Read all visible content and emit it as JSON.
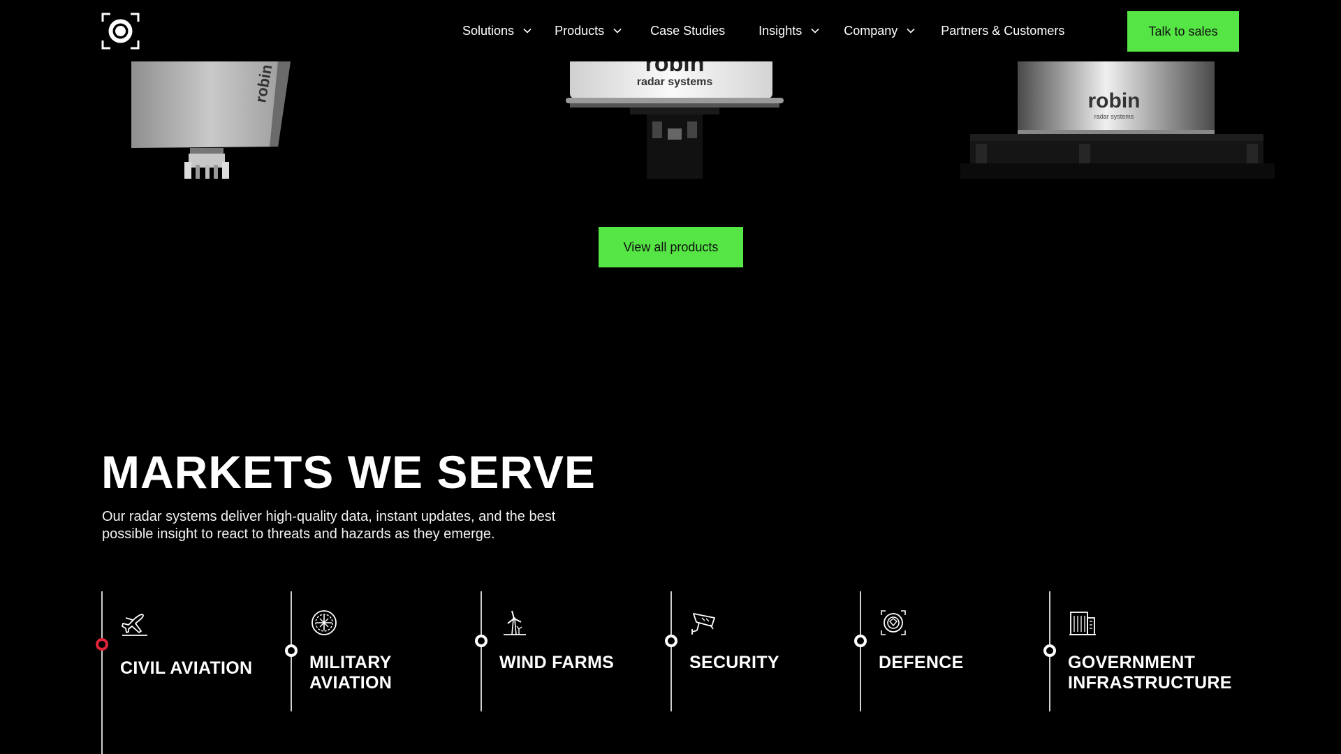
{
  "header": {
    "logo": "camera-aperture-logo",
    "nav": [
      {
        "label": "Solutions",
        "dropdown": true
      },
      {
        "label": "Products",
        "dropdown": true
      },
      {
        "label": "Case Studies",
        "dropdown": false
      },
      {
        "label": "Insights",
        "dropdown": true
      },
      {
        "label": "Company",
        "dropdown": true
      },
      {
        "label": "Partners & Customers",
        "dropdown": false
      }
    ],
    "cta_label": "Talk to sales"
  },
  "products": {
    "brand_text": "robin",
    "brand_sub": "radar systems",
    "view_all_label": "View all products"
  },
  "markets": {
    "title": "MARKETS WE SERVE",
    "description": "Our radar systems deliver high-quality data, instant updates, and the best possible insight to react to threats and hazards as they emerge.",
    "items": [
      {
        "label": "CIVIL AVIATION",
        "icon": "plane-icon",
        "active": true
      },
      {
        "label": "MILITARY AVIATION",
        "icon": "military-target-icon",
        "active": false
      },
      {
        "label": "WIND FARMS",
        "icon": "wind-turbine-icon",
        "active": false
      },
      {
        "label": "SECURITY",
        "icon": "security-camera-icon",
        "active": false
      },
      {
        "label": "DEFENCE",
        "icon": "defence-shield-icon",
        "active": false
      },
      {
        "label": "GOVERNMENT INFRASTRUCTURE",
        "icon": "building-icon",
        "active": false
      }
    ]
  },
  "colors": {
    "accent_green": "#55e544",
    "active_dot": "#e0243a",
    "background": "#000000"
  }
}
